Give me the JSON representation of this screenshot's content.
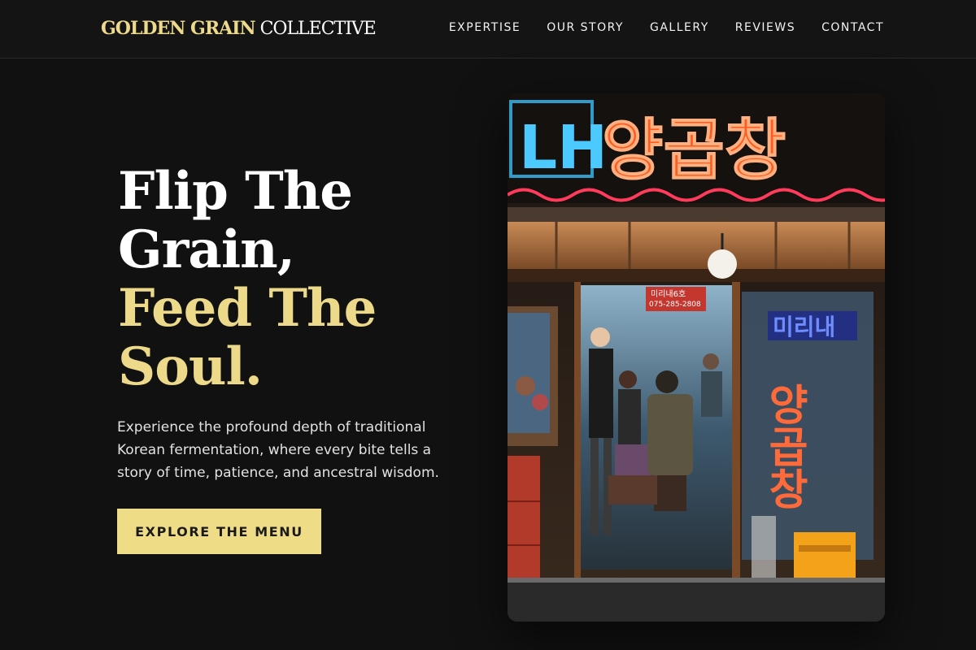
{
  "brand": {
    "name_gold": "GOLDEN GRAIN",
    "name_white": "COLLECTIVE"
  },
  "nav": {
    "items": [
      "EXPERTISE",
      "OUR STORY",
      "GALLERY",
      "REVIEWS",
      "CONTACT"
    ]
  },
  "hero": {
    "headline_white_1": "Flip The",
    "headline_white_2": "Grain,",
    "headline_gold_1": "Feed The",
    "headline_gold_2": "Soul.",
    "description": "Experience the profound depth of traditional Korean fermentation, where every bite tells a story of time, patience, and ancestral wisdom.",
    "cta_label": "EXPLORE THE MENU"
  },
  "photo": {
    "sign_latin": "LH",
    "sign_korean": "양곱창",
    "banner_text": "미리내6호",
    "phone_text": "075-285-2808",
    "window_sign_top": "미리내",
    "window_sign_vertical": "양곱창"
  },
  "colors": {
    "accent_gold": "#ecd98a",
    "button_gold": "#efdc87",
    "background": "#111111"
  }
}
